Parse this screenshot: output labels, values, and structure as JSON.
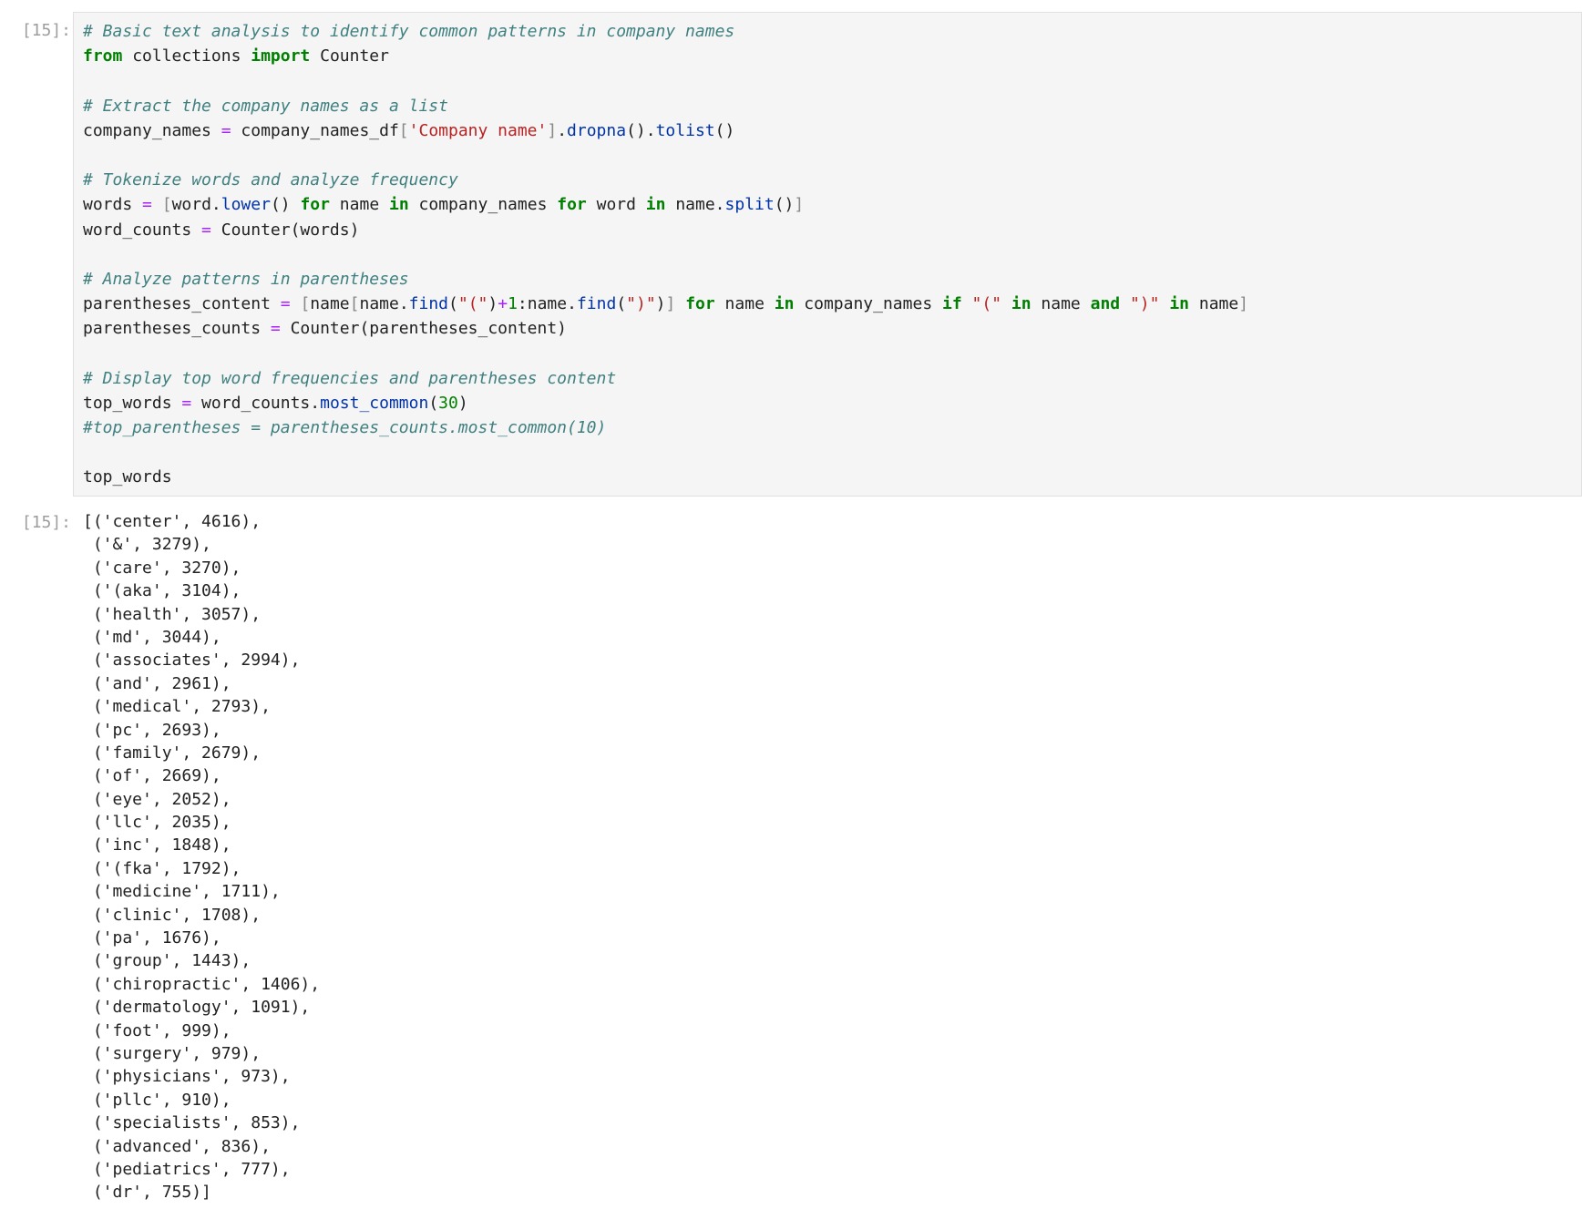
{
  "input_cell": {
    "prompt": "[15]:",
    "lines": [
      {
        "tokens": [
          {
            "t": "# Basic text analysis to identify common patterns in company names",
            "c": "comment"
          }
        ]
      },
      {
        "tokens": [
          {
            "t": "from",
            "c": "kw"
          },
          {
            "t": " collections ",
            "c": ""
          },
          {
            "t": "import",
            "c": "kw"
          },
          {
            "t": " Counter",
            "c": ""
          }
        ]
      },
      {
        "tokens": []
      },
      {
        "tokens": [
          {
            "t": "# Extract the company names as a list",
            "c": "comment"
          }
        ]
      },
      {
        "tokens": [
          {
            "t": "company_names ",
            "c": ""
          },
          {
            "t": "=",
            "c": "op"
          },
          {
            "t": " company_names_df",
            "c": ""
          },
          {
            "t": "[",
            "c": "bracket"
          },
          {
            "t": "'Company name'",
            "c": "str"
          },
          {
            "t": "]",
            "c": "bracket"
          },
          {
            "t": ".",
            "c": ""
          },
          {
            "t": "dropna",
            "c": "attr"
          },
          {
            "t": "().",
            "c": ""
          },
          {
            "t": "tolist",
            "c": "attr"
          },
          {
            "t": "()",
            "c": ""
          }
        ]
      },
      {
        "tokens": []
      },
      {
        "tokens": [
          {
            "t": "# Tokenize words and analyze frequency",
            "c": "comment"
          }
        ]
      },
      {
        "tokens": [
          {
            "t": "words ",
            "c": ""
          },
          {
            "t": "=",
            "c": "op"
          },
          {
            "t": " ",
            "c": ""
          },
          {
            "t": "[",
            "c": "bracket"
          },
          {
            "t": "word.",
            "c": ""
          },
          {
            "t": "lower",
            "c": "attr"
          },
          {
            "t": "() ",
            "c": ""
          },
          {
            "t": "for",
            "c": "kw"
          },
          {
            "t": " name ",
            "c": ""
          },
          {
            "t": "in",
            "c": "kw"
          },
          {
            "t": " company_names ",
            "c": ""
          },
          {
            "t": "for",
            "c": "kw"
          },
          {
            "t": " word ",
            "c": ""
          },
          {
            "t": "in",
            "c": "kw"
          },
          {
            "t": " name.",
            "c": ""
          },
          {
            "t": "split",
            "c": "attr"
          },
          {
            "t": "()",
            "c": ""
          },
          {
            "t": "]",
            "c": "bracket"
          }
        ]
      },
      {
        "tokens": [
          {
            "t": "word_counts ",
            "c": ""
          },
          {
            "t": "=",
            "c": "op"
          },
          {
            "t": " Counter(words)",
            "c": ""
          }
        ]
      },
      {
        "tokens": []
      },
      {
        "tokens": [
          {
            "t": "# Analyze patterns in parentheses",
            "c": "comment"
          }
        ]
      },
      {
        "tokens": [
          {
            "t": "parentheses_content ",
            "c": ""
          },
          {
            "t": "=",
            "c": "op"
          },
          {
            "t": " ",
            "c": ""
          },
          {
            "t": "[",
            "c": "bracket"
          },
          {
            "t": "name",
            "c": ""
          },
          {
            "t": "[",
            "c": "bracket"
          },
          {
            "t": "name.",
            "c": ""
          },
          {
            "t": "find",
            "c": "attr"
          },
          {
            "t": "(",
            "c": ""
          },
          {
            "t": "\"(\"",
            "c": "str"
          },
          {
            "t": ")",
            "c": ""
          },
          {
            "t": "+",
            "c": "op"
          },
          {
            "t": "1",
            "c": "num"
          },
          {
            "t": ":name.",
            "c": ""
          },
          {
            "t": "find",
            "c": "attr"
          },
          {
            "t": "(",
            "c": ""
          },
          {
            "t": "\")\"",
            "c": "str"
          },
          {
            "t": ")",
            "c": ""
          },
          {
            "t": "]",
            "c": "bracket"
          },
          {
            "t": " ",
            "c": ""
          },
          {
            "t": "for",
            "c": "kw"
          },
          {
            "t": " name ",
            "c": ""
          },
          {
            "t": "in",
            "c": "kw"
          },
          {
            "t": " company_names ",
            "c": ""
          },
          {
            "t": "if",
            "c": "kw"
          },
          {
            "t": " ",
            "c": ""
          },
          {
            "t": "\"(\"",
            "c": "str"
          },
          {
            "t": " ",
            "c": ""
          },
          {
            "t": "in",
            "c": "kw"
          },
          {
            "t": " name ",
            "c": ""
          },
          {
            "t": "and",
            "c": "kw"
          },
          {
            "t": " ",
            "c": ""
          },
          {
            "t": "\")\"",
            "c": "str"
          },
          {
            "t": " ",
            "c": ""
          },
          {
            "t": "in",
            "c": "kw"
          },
          {
            "t": " name",
            "c": ""
          },
          {
            "t": "]",
            "c": "bracket"
          }
        ]
      },
      {
        "tokens": [
          {
            "t": "parentheses_counts ",
            "c": ""
          },
          {
            "t": "=",
            "c": "op"
          },
          {
            "t": " Counter(parentheses_content)",
            "c": ""
          }
        ]
      },
      {
        "tokens": []
      },
      {
        "tokens": [
          {
            "t": "# Display top word frequencies and parentheses content",
            "c": "comment"
          }
        ]
      },
      {
        "tokens": [
          {
            "t": "top_words ",
            "c": ""
          },
          {
            "t": "=",
            "c": "op"
          },
          {
            "t": " word_counts.",
            "c": ""
          },
          {
            "t": "most_common",
            "c": "attr"
          },
          {
            "t": "(",
            "c": ""
          },
          {
            "t": "30",
            "c": "num"
          },
          {
            "t": ")",
            "c": ""
          }
        ]
      },
      {
        "tokens": [
          {
            "t": "#top_parentheses = parentheses_counts.most_common(10)",
            "c": "comment"
          }
        ]
      },
      {
        "tokens": []
      },
      {
        "tokens": [
          {
            "t": "top_words",
            "c": ""
          }
        ]
      }
    ]
  },
  "output_cell": {
    "prompt": "[15]:",
    "lines": [
      "[('center', 4616),",
      " ('&', 3279),",
      " ('care', 3270),",
      " ('(aka', 3104),",
      " ('health', 3057),",
      " ('md', 3044),",
      " ('associates', 2994),",
      " ('and', 2961),",
      " ('medical', 2793),",
      " ('pc', 2693),",
      " ('family', 2679),",
      " ('of', 2669),",
      " ('eye', 2052),",
      " ('llc', 2035),",
      " ('inc', 1848),",
      " ('(fka', 1792),",
      " ('medicine', 1711),",
      " ('clinic', 1708),",
      " ('pa', 1676),",
      " ('group', 1443),",
      " ('chiropractic', 1406),",
      " ('dermatology', 1091),",
      " ('foot', 999),",
      " ('surgery', 979),",
      " ('physicians', 973),",
      " ('pllc', 910),",
      " ('specialists', 853),",
      " ('advanced', 836),",
      " ('pediatrics', 777),",
      " ('dr', 755)]"
    ]
  }
}
